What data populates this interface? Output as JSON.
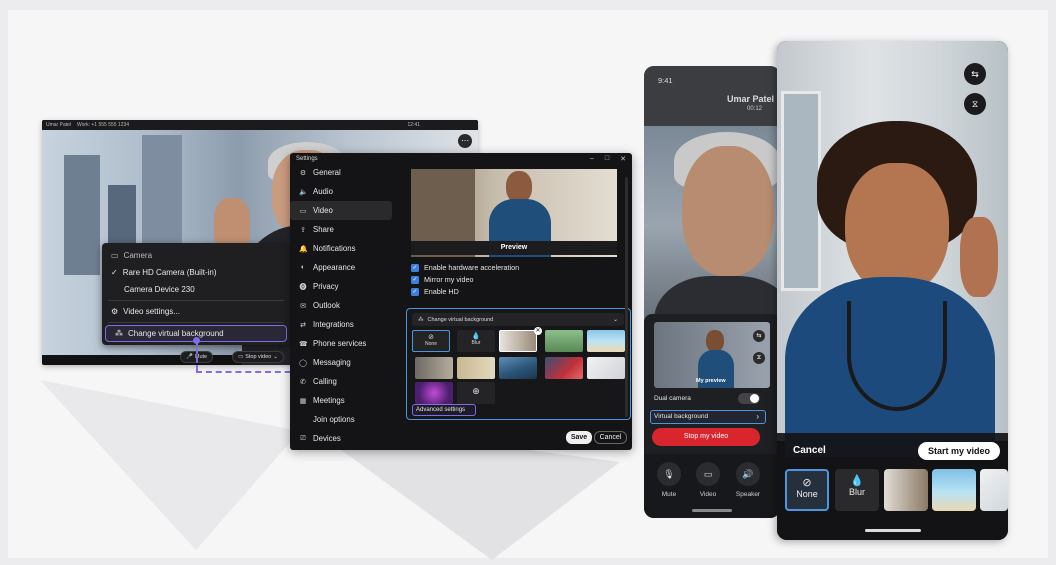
{
  "desktop": {
    "title": "Umar Patel",
    "subtitle": "Work: +1 555 555 1234",
    "time": "12:41",
    "camera_menu": {
      "header": "Camera",
      "devices": [
        "Rare HD Camera (Built-in)",
        "Camera Device 230"
      ],
      "video_settings": "Video settings...",
      "change_bg": "Change virtual background"
    },
    "mute_label": "Mute",
    "stop_video_label": "Stop video"
  },
  "settings": {
    "title": "Settings",
    "nav": [
      {
        "icon": "⚙",
        "label": "General"
      },
      {
        "icon": "🔈",
        "label": "Audio"
      },
      {
        "icon": "▭",
        "label": "Video"
      },
      {
        "icon": "⇪",
        "label": "Share"
      },
      {
        "icon": "🔔",
        "label": "Notifications"
      },
      {
        "icon": "◐",
        "label": "Appearance"
      },
      {
        "icon": "⓿",
        "label": "Privacy"
      },
      {
        "icon": "✉",
        "label": "Outlook"
      },
      {
        "icon": "⇄",
        "label": "Integrations"
      },
      {
        "icon": "☎",
        "label": "Phone services"
      },
      {
        "icon": "◯",
        "label": "Messaging"
      },
      {
        "icon": "✆",
        "label": "Calling"
      },
      {
        "icon": "▦",
        "label": "Meetings"
      },
      {
        "icon": "",
        "label": "Join options"
      },
      {
        "icon": "⎚",
        "label": "Devices"
      }
    ],
    "preview_label": "Preview",
    "checkboxes": [
      "Enable hardware acceleration",
      "Mirror my video",
      "Enable HD"
    ],
    "vb_dropdown": "Change virtual background",
    "vb_none": "None",
    "vb_blur": "Blur",
    "advanced": "Advanced settings",
    "save": "Save",
    "cancel": "Cancel"
  },
  "phone_back": {
    "time": "9:41",
    "name": "Umar Patel",
    "duration": "00:12",
    "mini_label": "My preview",
    "dual_camera": "Dual camera",
    "virtual_background": "Virtual background",
    "stop_video": "Stop my video",
    "controls": [
      "Mute",
      "Video",
      "Speaker"
    ]
  },
  "phone_front": {
    "cancel": "Cancel",
    "start_video": "Start my video",
    "none": "None",
    "blur": "Blur"
  },
  "colors": {
    "accent_purple": "#7b6ee8",
    "accent_blue": "#4a97e0",
    "stop_red": "#d9262e"
  }
}
